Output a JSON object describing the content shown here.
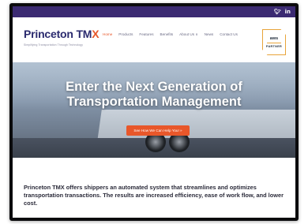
{
  "topbar": {
    "social": [
      {
        "icon": "twitter-icon",
        "glyph": "🐦︎"
      },
      {
        "icon": "linkedin-icon",
        "glyph": "in"
      }
    ]
  },
  "header": {
    "logo": {
      "primary": "Princeton TM",
      "accent": "X",
      "tagline": "Simplifying Transportation Through Technology"
    },
    "nav": [
      "Home",
      "Products",
      "Features",
      "Benefits",
      "About Us ∨",
      "News",
      "Contact Us"
    ],
    "active_nav": "Home",
    "badge": {
      "top": "aws",
      "bottom": "PARTNER"
    }
  },
  "hero": {
    "title_line1": "Enter the Next Generation of",
    "title_line2": "Transportation Management",
    "cta": "See How We Can Help You! »"
  },
  "intro": {
    "text": "Princeton TMX offers shippers an automated system that streamlines and optimizes transportation transactions. The results are increased efficiency, ease of work flow, and lower cost."
  },
  "colors": {
    "topbar": "#3b2a72",
    "brand_navy": "#2a2a6e",
    "accent_orange": "#e8572a",
    "badge_border": "#e8a43a"
  }
}
